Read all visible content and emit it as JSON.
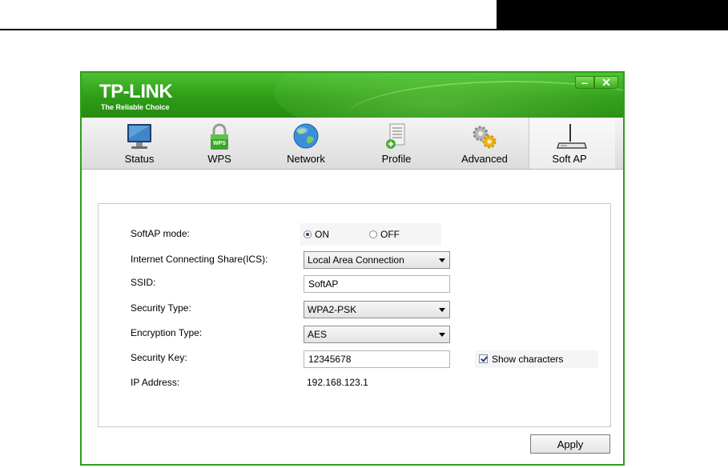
{
  "window": {
    "brand": "TP-LINK",
    "tagline": "The Reliable Choice",
    "minimize_glyph": "–",
    "close_glyph": "✕"
  },
  "tabs": [
    {
      "label": "Status",
      "icon": "monitor-icon"
    },
    {
      "label": "WPS",
      "icon": "wps-lock-icon"
    },
    {
      "label": "Network",
      "icon": "globe-icon"
    },
    {
      "label": "Profile",
      "icon": "profile-document-icon"
    },
    {
      "label": "Advanced",
      "icon": "gears-icon"
    },
    {
      "label": "Soft AP",
      "icon": "router-icon",
      "active": true
    }
  ],
  "form": {
    "softap_mode_label": "SoftAP mode:",
    "on_label": "ON",
    "off_label": "OFF",
    "selected_mode": "ON",
    "ics_label": "Internet Connecting Share(ICS):",
    "ics_value": "Local Area Connection",
    "ssid_label": "SSID:",
    "ssid_value": "SoftAP",
    "security_type_label": "Security Type:",
    "security_type_value": "WPA2-PSK",
    "encryption_type_label": "Encryption Type:",
    "encryption_type_value": "AES",
    "security_key_label": "Security Key:",
    "security_key_value": "12345678",
    "show_characters_label": "Show characters",
    "show_characters_checked": true,
    "ip_address_label": "IP Address:",
    "ip_address_value": "192.168.123.1"
  },
  "apply_label": "Apply",
  "colors": {
    "brand_green": "#2e9c17",
    "accent_dark": "#2a3d7a"
  }
}
